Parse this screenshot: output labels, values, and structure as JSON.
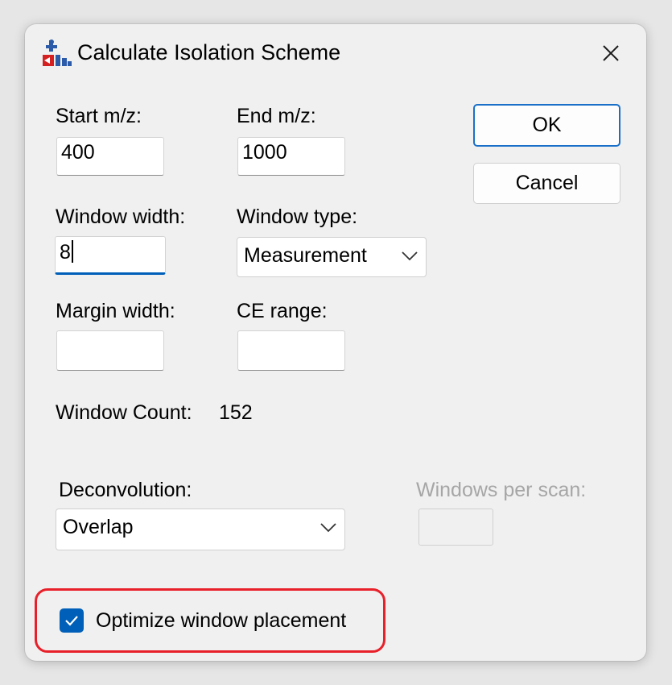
{
  "dialog": {
    "title": "Calculate Isolation Scheme",
    "icons": {
      "app": "app-logo-icon",
      "close": "close-icon"
    }
  },
  "fields": {
    "start_mz": {
      "label": "Start m/z:",
      "value": "400"
    },
    "end_mz": {
      "label": "End m/z:",
      "value": "1000"
    },
    "window_width": {
      "label": "Window width:",
      "value": "8"
    },
    "window_type": {
      "label": "Window type:",
      "selected": "Measurement"
    },
    "margin_width": {
      "label": "Margin width:",
      "value": ""
    },
    "ce_range": {
      "label": "CE range:",
      "value": ""
    }
  },
  "window_count": {
    "label": "Window Count:",
    "value": "152"
  },
  "deconvolution": {
    "label": "Deconvolution:",
    "selected": "Overlap"
  },
  "windows_per_scan": {
    "label": "Windows per scan:",
    "value": "",
    "enabled": false
  },
  "optimize": {
    "label": "Optimize window placement",
    "checked": true
  },
  "buttons": {
    "ok": "OK",
    "cancel": "Cancel"
  },
  "colors": {
    "accent": "#005fb8",
    "highlight": "#e8202a",
    "disabled_text": "#a6a6a6"
  }
}
